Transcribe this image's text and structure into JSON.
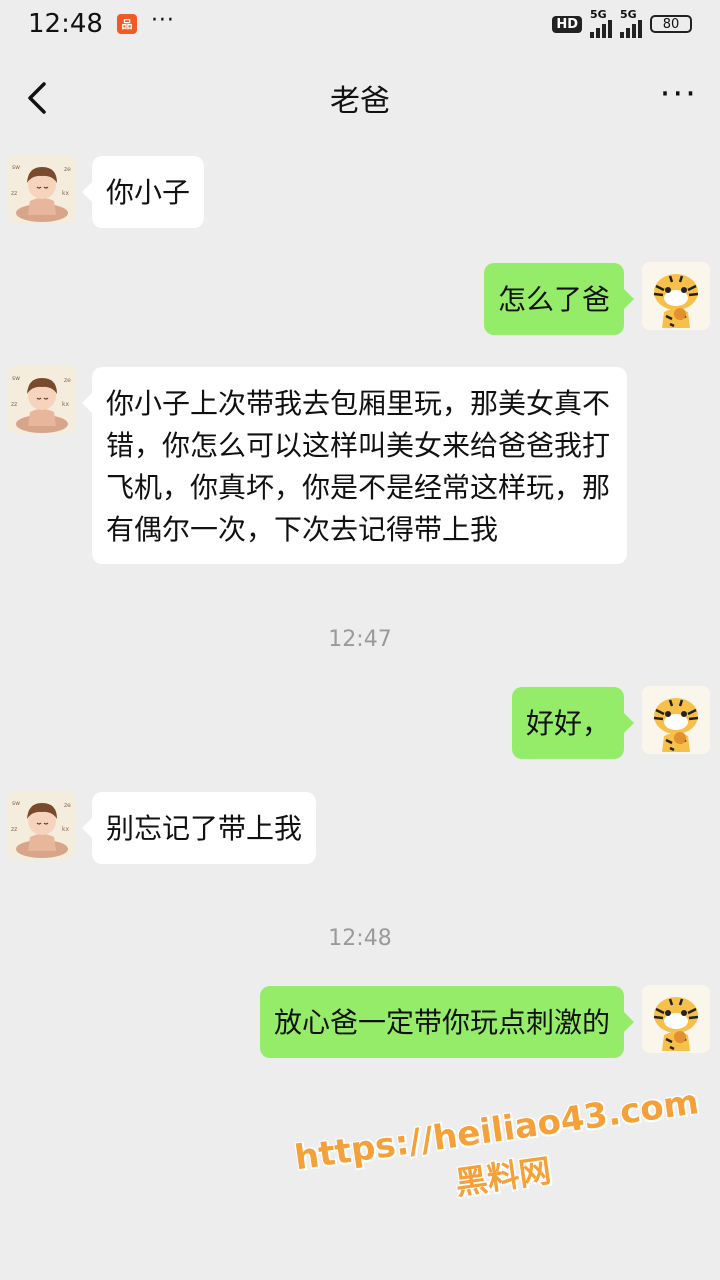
{
  "status_bar": {
    "time": "12:48",
    "app_badge": "品",
    "more": "···",
    "hd": "HD",
    "net1": "5G",
    "net2": "5G",
    "battery": "80"
  },
  "header": {
    "title": "老爸",
    "more": "···"
  },
  "messages": [
    {
      "side": "in",
      "text": "你小子"
    },
    {
      "side": "out",
      "text": "怎么了爸"
    },
    {
      "side": "in",
      "text": "你小子上次带我去包厢里玩，那美女真不错，你怎么可以这样叫美女来给爸爸我打飞机，你真坏，你是不是经常这样玩，那有偶尔一次，下次去记得带上我"
    },
    {
      "side": "out",
      "text": "好好，"
    },
    {
      "side": "in",
      "text": "别忘记了带上我"
    },
    {
      "side": "out",
      "text": "放心爸一定带你玩点刺激的"
    }
  ],
  "timestamps": [
    "12:47",
    "12:48"
  ],
  "watermark": {
    "url": "https://heiliao43.com",
    "site": "黑料网"
  },
  "colors": {
    "background": "#ededed",
    "incoming_bubble": "#ffffff",
    "outgoing_bubble": "#95ec69",
    "watermark": "#f5a038"
  }
}
